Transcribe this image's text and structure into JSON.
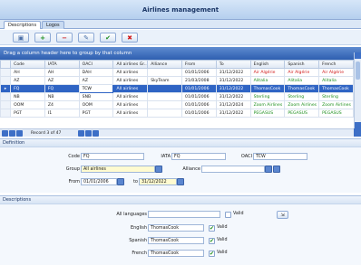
{
  "window": {
    "title": "Airlines management"
  },
  "tabs": [
    {
      "label": "Descriptions"
    },
    {
      "label": "Logos"
    }
  ],
  "toolbar": {
    "buttons": [
      {
        "name": "save-icon",
        "glyph": "▣",
        "color": "#4a6fa8"
      },
      {
        "name": "add-icon",
        "glyph": "+",
        "color": "#1e8f1e"
      },
      {
        "name": "remove-icon",
        "glyph": "−",
        "color": "#d01818"
      },
      {
        "name": "edit-icon",
        "glyph": "✎",
        "color": "#4a6fa8"
      },
      {
        "name": "confirm-icon",
        "glyph": "✔",
        "color": "#1e8f1e"
      },
      {
        "name": "cancel-icon",
        "glyph": "✖",
        "color": "#d01818"
      }
    ]
  },
  "grid": {
    "group_hint": "Drag a column header here to group by that column",
    "columns": [
      "Code",
      "IATA",
      "OACI",
      "All airlines Gr...",
      "Alliance",
      "From",
      "To",
      "English",
      "Spanish",
      "French"
    ],
    "rows": [
      {
        "indicator": "",
        "cells": [
          "AH",
          "AH",
          "DAH",
          "All airlines",
          "",
          "01/01/2006",
          "31/12/2022",
          "Air Algérie",
          "Air Algérie",
          "Air Algérie"
        ],
        "color": "red"
      },
      {
        "indicator": "",
        "cells": [
          "AZ",
          "AZ",
          "AZ",
          "All airlines",
          "SkyTeam",
          "21/03/2008",
          "31/12/2022",
          "Alitalia",
          "Alitalia",
          "Alitalia"
        ],
        "color": "green"
      },
      {
        "indicator": "▸",
        "cells": [
          "FQ",
          "FQ",
          "TCW",
          "All airlines",
          "",
          "01/01/2006",
          "31/12/2022",
          "ThomasCook",
          "ThomasCook",
          "ThomasCook"
        ],
        "color": "green",
        "selected": true
      },
      {
        "indicator": "",
        "cells": [
          "NB",
          "NB",
          "SNB",
          "All airlines",
          "",
          "01/01/2006",
          "31/12/2022",
          "Sterling",
          "Sterling",
          "Sterling"
        ],
        "color": "green"
      },
      {
        "indicator": "",
        "cells": [
          "OOM",
          "Z4",
          "OOM",
          "All airlines",
          "",
          "01/01/2006",
          "31/12/2024",
          "Zoom Airlines",
          "Zoom Airlines",
          "Zoom Airlines"
        ],
        "color": "green"
      },
      {
        "indicator": "",
        "cells": [
          "PGT",
          "I1",
          "PGT",
          "All airlines",
          "",
          "01/01/2006",
          "31/12/2022",
          "PEGASUS",
          "PEGASUS",
          "PEGASUS"
        ],
        "color": "green"
      }
    ],
    "record_text": "Record 3 of 47"
  },
  "definition": {
    "section_label": "Definition",
    "code_label": "Code",
    "code_value": "FQ",
    "iata_label": "IATA",
    "iata_value": "FQ",
    "oaci_label": "OACI",
    "oaci_value": "TCW",
    "group_label": "Group",
    "group_value": "All airlines",
    "alliance_label": "Alliance",
    "alliance_value": "",
    "from_label": "From",
    "from_value": "01/01/2006",
    "to_label": "to",
    "to_value": "31/12/2022"
  },
  "descriptions": {
    "section_label": "Descriptions",
    "all_languages_label": "All languages",
    "all_languages_value": "",
    "valid_label": "Valid",
    "apply_button_glyph": "⇲",
    "languages": [
      {
        "label": "English",
        "value": "ThomasCook",
        "valid_label": "Valid",
        "checked": true
      },
      {
        "label": "Spanish",
        "value": "ThomasCook",
        "valid_label": "Valid",
        "checked": true
      },
      {
        "label": "French",
        "value": "ThomasCook",
        "valid_label": "Valid",
        "checked": true
      }
    ]
  },
  "colors": {
    "accent": "#2f64c4",
    "valid_text": "#1e8f1e",
    "invalid_text": "#d01818",
    "highlight_field": "#fffbd0"
  }
}
